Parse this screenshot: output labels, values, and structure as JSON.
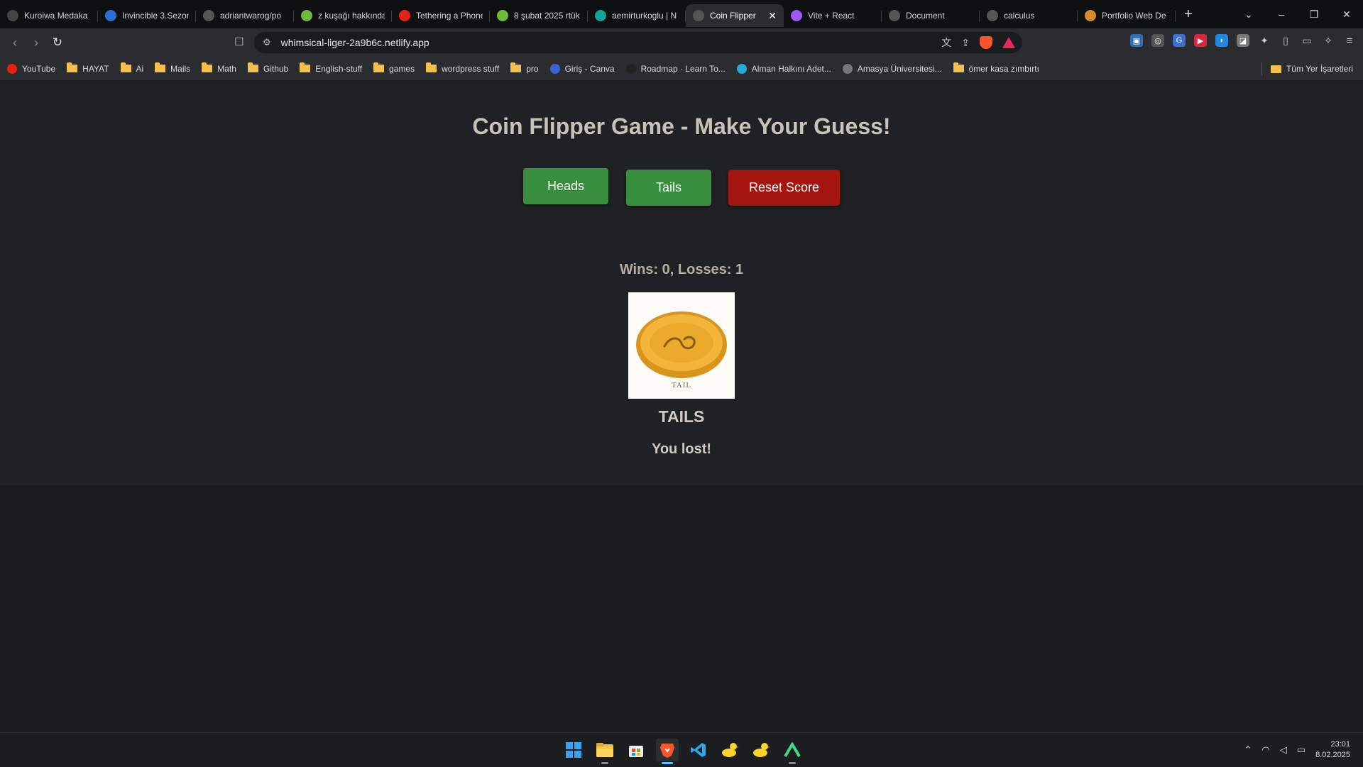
{
  "browser": {
    "tabs": [
      {
        "label": "Kuroiwa Medaka",
        "fav_color": "#444",
        "active": false
      },
      {
        "label": "Invincible 3.Sezon",
        "fav_color": "#2a6fd6",
        "active": false
      },
      {
        "label": "adriantwarog/po",
        "fav_color": "#555",
        "active": false
      },
      {
        "label": "z kuşağı hakkında",
        "fav_color": "#6dbb3a",
        "active": false
      },
      {
        "label": "Tethering a Phone",
        "fav_color": "#e62117",
        "active": false
      },
      {
        "label": "8 şubat 2025 rtük",
        "fav_color": "#6dbb3a",
        "active": false
      },
      {
        "label": "aemirturkoglu | N",
        "fav_color": "#14a39a",
        "active": false
      },
      {
        "label": "Coin Flipper",
        "fav_color": "#555",
        "active": true
      },
      {
        "label": "Vite + React",
        "fav_color": "#9b59f5",
        "active": false
      },
      {
        "label": "Document",
        "fav_color": "#555",
        "active": false
      },
      {
        "label": "calculus",
        "fav_color": "#555",
        "active": false
      },
      {
        "label": "Portfolio Web De",
        "fav_color": "#d98a2b",
        "active": false
      }
    ],
    "url": "whimsical-liger-2a9b6c.netlify.app",
    "bookmarks": [
      {
        "label": "YouTube",
        "kind": "youtube"
      },
      {
        "label": "HAYAT",
        "kind": "folder"
      },
      {
        "label": "Ai",
        "kind": "folder"
      },
      {
        "label": "Mails",
        "kind": "folder"
      },
      {
        "label": "Math",
        "kind": "folder"
      },
      {
        "label": "Github",
        "kind": "folder"
      },
      {
        "label": "English-stuff",
        "kind": "folder"
      },
      {
        "label": "games",
        "kind": "folder"
      },
      {
        "label": "wordpress stuff",
        "kind": "folder"
      },
      {
        "label": "pro",
        "kind": "folder"
      },
      {
        "label": "Giriş - Canva",
        "kind": "canva"
      },
      {
        "label": "Roadmap · Learn To...",
        "kind": "roadmap"
      },
      {
        "label": "Alman Halkını Adet...",
        "kind": "drop"
      },
      {
        "label": "Amasya Üniversitesi...",
        "kind": "globe"
      },
      {
        "label": "ömer kasa zımbırtı",
        "kind": "folder"
      }
    ],
    "bookmarks_all": "Tüm Yer İşaretleri"
  },
  "game": {
    "title": "Coin Flipper Game - Make Your Guess!",
    "buttons": {
      "heads": "Heads",
      "tails": "Tails",
      "reset": "Reset Score"
    },
    "score_text": "Wins: 0, Losses: 1",
    "coin_caption": "TAIL",
    "result_side": "TAILS",
    "result_message": "You lost!"
  },
  "taskbar": {
    "time": "23:01",
    "date": "8.02.2025"
  },
  "colors": {
    "heads_btn": "#388e3c",
    "tails_btn": "#388e3c",
    "reset_btn": "#a3150e",
    "coin": "#f4b63a"
  }
}
